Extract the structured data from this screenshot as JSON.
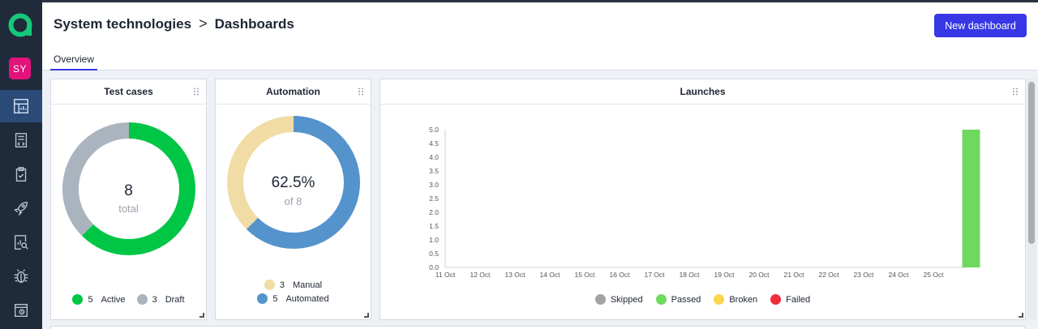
{
  "header": {
    "breadcrumb_project": "System technologies",
    "breadcrumb_separator": ">",
    "breadcrumb_page": "Dashboards",
    "new_button": "New dashboard"
  },
  "sidebar": {
    "avatar": "SY",
    "items": [
      {
        "icon": "dashboard-icon",
        "active": true
      },
      {
        "icon": "test-cases-icon",
        "active": false
      },
      {
        "icon": "test-plans-icon",
        "active": false
      },
      {
        "icon": "launches-rocket-icon",
        "active": false
      },
      {
        "icon": "analytics-icon",
        "active": false
      },
      {
        "icon": "defects-bug-icon",
        "active": false
      },
      {
        "icon": "jobs-icon",
        "active": false
      }
    ]
  },
  "tabs": [
    "Overview"
  ],
  "widgets": {
    "test_cases": {
      "title": "Test cases",
      "total": "8",
      "total_label": "total",
      "legend": [
        {
          "count": "5",
          "label": "Active",
          "color": "#00c646"
        },
        {
          "count": "3",
          "label": "Draft",
          "color": "#aab4bf"
        }
      ]
    },
    "automation": {
      "title": "Automation",
      "percent": "62.5%",
      "of_label": "of 8",
      "legend": [
        {
          "count": "3",
          "label": "Manual",
          "color": "#f0dca4"
        },
        {
          "count": "5",
          "label": "Automated",
          "color": "#5493cc"
        }
      ]
    },
    "launches": {
      "title": "Launches",
      "legend": [
        {
          "label": "Skipped",
          "color": "#a3a3a3"
        },
        {
          "label": "Passed",
          "color": "#6fd95f"
        },
        {
          "label": "Broken",
          "color": "#fbd54b"
        },
        {
          "label": "Failed",
          "color": "#ee2e3d"
        }
      ]
    }
  },
  "chart_data": [
    {
      "type": "pie",
      "title": "Test cases",
      "categories": [
        "Active",
        "Draft"
      ],
      "values": [
        5,
        3
      ]
    },
    {
      "type": "pie",
      "title": "Automation",
      "categories": [
        "Manual",
        "Automated"
      ],
      "values": [
        3,
        5
      ]
    },
    {
      "type": "bar",
      "title": "Launches",
      "categories": [
        "11 Oct",
        "12 Oct",
        "13 Oct",
        "14 Oct",
        "15 Oct",
        "16 Oct",
        "17 Oct",
        "18 Oct",
        "19 Oct",
        "20 Oct",
        "21 Oct",
        "22 Oct",
        "23 Oct",
        "24 Oct",
        "25 Oct"
      ],
      "series": [
        {
          "name": "Skipped",
          "values": [
            0,
            0,
            0,
            0,
            0,
            0,
            0,
            0,
            0,
            0,
            0,
            0,
            0,
            0,
            0
          ]
        },
        {
          "name": "Passed",
          "values": [
            0,
            0,
            0,
            0,
            0,
            0,
            0,
            0,
            0,
            0,
            0,
            0,
            0,
            0,
            5
          ]
        },
        {
          "name": "Broken",
          "values": [
            0,
            0,
            0,
            0,
            0,
            0,
            0,
            0,
            0,
            0,
            0,
            0,
            0,
            0,
            0
          ]
        },
        {
          "name": "Failed",
          "values": [
            0,
            0,
            0,
            0,
            0,
            0,
            0,
            0,
            0,
            0,
            0,
            0,
            0,
            0,
            0
          ]
        }
      ],
      "ylim": [
        0,
        5
      ],
      "yticks": [
        "0.0",
        "0.5",
        "1.0",
        "1.5",
        "2.0",
        "2.5",
        "3.0",
        "3.5",
        "4.0",
        "4.5",
        "5.0"
      ],
      "legend_position": "bottom"
    }
  ]
}
